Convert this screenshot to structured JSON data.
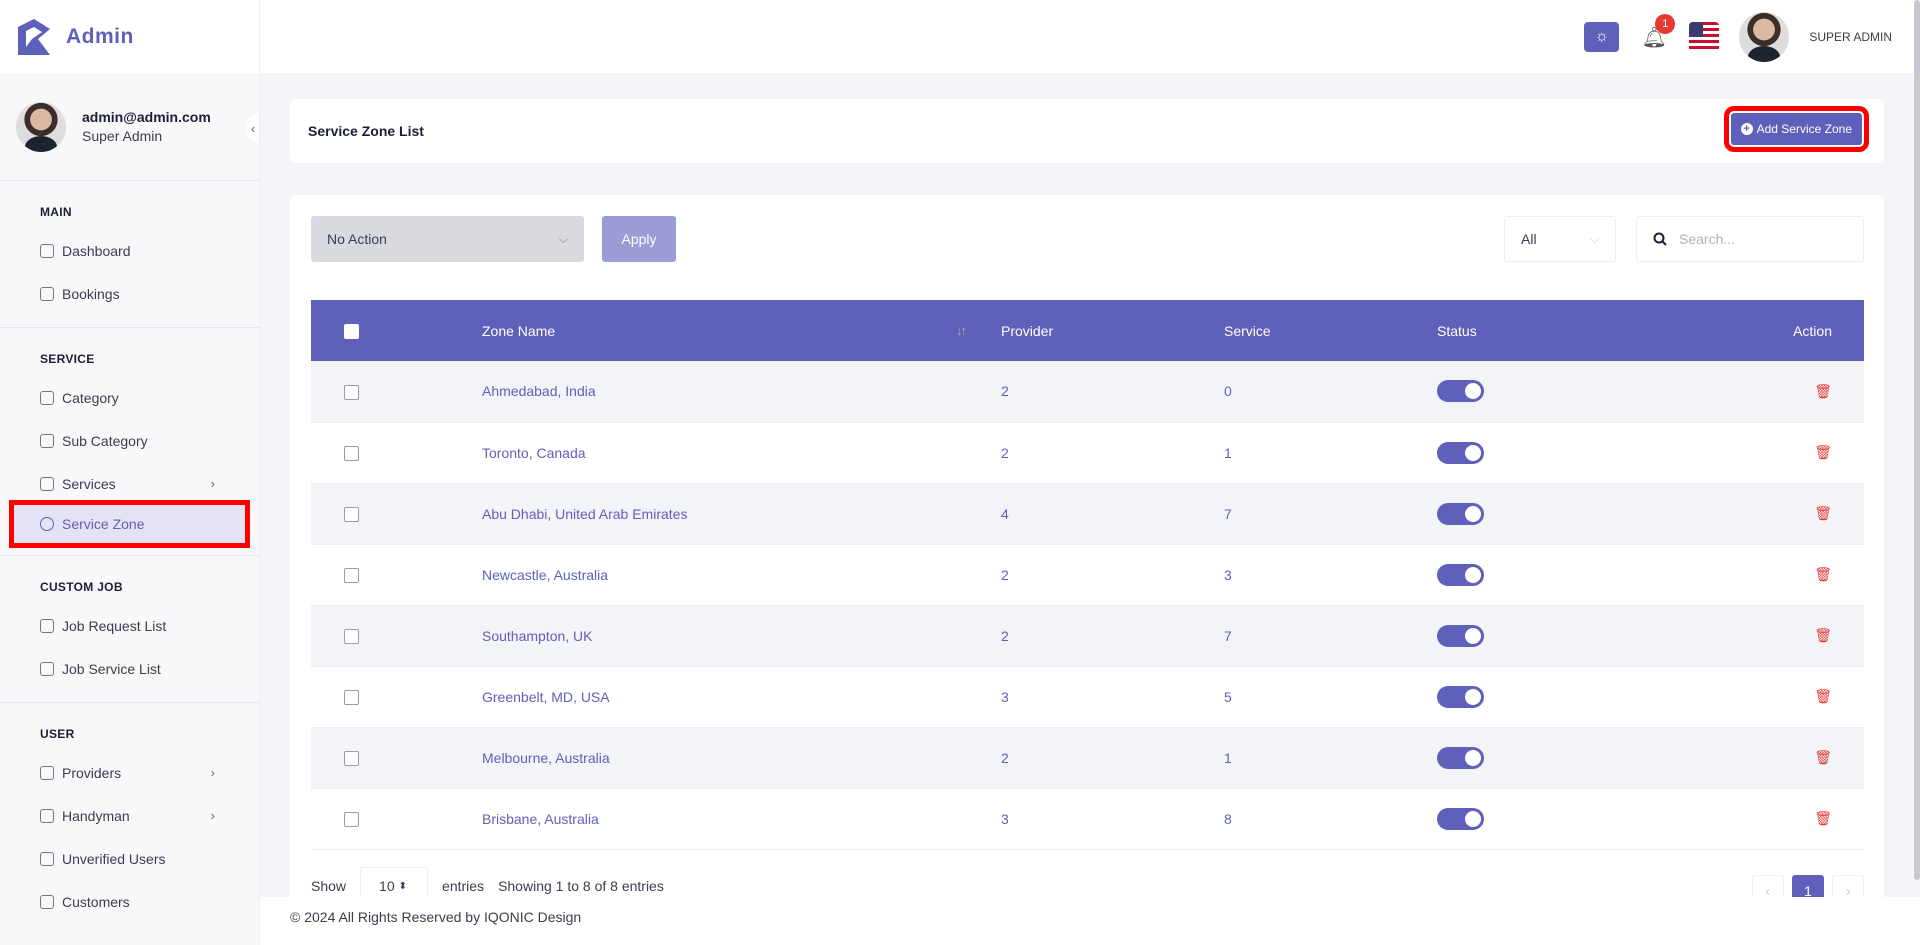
{
  "brand": {
    "name": "Admin"
  },
  "profile": {
    "email": "admin@admin.com",
    "role": "Super Admin"
  },
  "sidebar": {
    "sections": [
      {
        "heading": "MAIN",
        "items": [
          {
            "label": "Dashboard",
            "icon": "dashboard-icon"
          },
          {
            "label": "Bookings",
            "icon": "calendar-icon"
          }
        ]
      },
      {
        "heading": "SERVICE",
        "items": [
          {
            "label": "Category",
            "icon": "category-icon"
          },
          {
            "label": "Sub Category",
            "icon": "subcategory-icon"
          },
          {
            "label": "Services",
            "icon": "services-icon",
            "has_children": true
          },
          {
            "label": "Service Zone",
            "icon": "globe-icon",
            "active": true
          }
        ]
      },
      {
        "heading": "CUSTOM JOB",
        "items": [
          {
            "label": "Job Request List",
            "icon": "briefcase-icon"
          },
          {
            "label": "Job Service List",
            "icon": "list-icon"
          }
        ]
      },
      {
        "heading": "USER",
        "items": [
          {
            "label": "Providers",
            "icon": "user-icon",
            "has_children": true
          },
          {
            "label": "Handyman",
            "icon": "user-icon",
            "has_children": true
          },
          {
            "label": "Unverified Users",
            "icon": "user-icon"
          },
          {
            "label": "Customers",
            "icon": "user-icon"
          }
        ]
      }
    ]
  },
  "header": {
    "notification_count": "1",
    "user_label": "SUPER ADMIN"
  },
  "page": {
    "title": "Service Zone List",
    "add_button_label": "Add Service Zone"
  },
  "toolbar": {
    "bulk_action_value": "No Action",
    "apply_label": "Apply",
    "filter_value": "All",
    "search_placeholder": "Search..."
  },
  "table": {
    "columns": [
      "Zone Name",
      "Provider",
      "Service",
      "Status",
      "Action"
    ],
    "rows": [
      {
        "zone": "Ahmedabad, India",
        "provider": "2",
        "service": "0",
        "status": true
      },
      {
        "zone": "Toronto, Canada",
        "provider": "2",
        "service": "1",
        "status": true
      },
      {
        "zone": "Abu Dhabi, United Arab Emirates",
        "provider": "4",
        "service": "7",
        "status": true
      },
      {
        "zone": "Newcastle, Australia",
        "provider": "2",
        "service": "3",
        "status": true
      },
      {
        "zone": "Southampton, UK",
        "provider": "2",
        "service": "7",
        "status": true
      },
      {
        "zone": "Greenbelt, MD, USA",
        "provider": "3",
        "service": "5",
        "status": true
      },
      {
        "zone": "Melbourne, Australia",
        "provider": "2",
        "service": "1",
        "status": true
      },
      {
        "zone": "Brisbane, Australia",
        "provider": "3",
        "service": "8",
        "status": true
      }
    ]
  },
  "pagination": {
    "show_label": "Show",
    "page_length": "10",
    "entries_label": "entries",
    "info": "Showing 1 to 8 of 8 entries",
    "current_page": "1"
  },
  "footer": {
    "text": "© 2024 All Rights Reserved by IQONIC Design"
  },
  "colors": {
    "accent": "#5f60b9",
    "danger": "#e53935",
    "highlight": "#ff0000"
  }
}
